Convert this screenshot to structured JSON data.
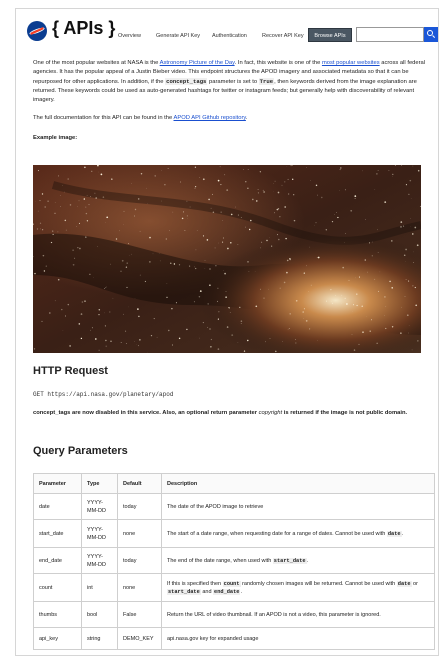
{
  "header": {
    "brand": "{ APIs }",
    "nav": [
      "Overview",
      "Generate API Key",
      "Authentication",
      "Recover API Key"
    ],
    "nav_active": "Browse APIs",
    "search_placeholder": ""
  },
  "intro": {
    "p1_a": "One of the most popular websites at NASA is the ",
    "p1_link1": "Astronomy Picture of the Day",
    "p1_b": ". In fact, this website is one of the ",
    "p1_link2": "most popular websites",
    "p1_c": " across all federal agencies. It has the popular appeal of a Justin Bieber video. This endpoint structures the APOD imagery and associated metadata so that it can be repurposed for other applications. In addition, if the ",
    "p1_code1": "concept_tags",
    "p1_d": " parameter is set to ",
    "p1_code2": "True",
    "p1_e": ", then keywords derived from the image explanation are returned. These keywords could be used as auto-generated hashtags for twitter or instagram feeds; but generally help with discoverability of relevant imagery.",
    "p2_a": "The full documentation for this API can be found in the ",
    "p2_link": "APOD API Github repository",
    "p2_b": ".",
    "example_label": "Example image:"
  },
  "http_request": {
    "heading": "HTTP Request",
    "url": "GET https://api.nasa.gov/planetary/apod",
    "note_a": "concept_tags are now disabled in this service. Also, an optional return parameter ",
    "note_em": "copyright",
    "note_b": " is returned if the image is not public domain."
  },
  "query": {
    "heading": "Query Parameters",
    "columns": [
      "Parameter",
      "Type",
      "Default",
      "Description"
    ],
    "rows": [
      {
        "param": "date",
        "type": "YYYY-MM-DD",
        "default": "today",
        "desc_a": "The date of the APOD image to retrieve",
        "code1": "",
        "desc_b": "",
        "code2": "",
        "desc_c": "",
        "code3": "",
        "desc_d": ""
      },
      {
        "param": "start_date",
        "type": "YYYY-MM-DD",
        "default": "none",
        "desc_a": "The start of a date range, when requesting date for a range of dates. Cannot be used with ",
        "code1": "date",
        "desc_b": ".",
        "code2": "",
        "desc_c": "",
        "code3": "",
        "desc_d": ""
      },
      {
        "param": "end_date",
        "type": "YYYY-MM-DD",
        "default": "today",
        "desc_a": "The end of the date range, when used with ",
        "code1": "start_date",
        "desc_b": ".",
        "code2": "",
        "desc_c": "",
        "code3": "",
        "desc_d": ""
      },
      {
        "param": "count",
        "type": "int",
        "default": "none",
        "desc_a": "If this is specified then ",
        "code1": "count",
        "desc_b": " randomly chosen images will be returned. Cannot be used with ",
        "code2": "date",
        "desc_c": " or ",
        "code3": "start_date",
        "desc_d": " and "
      },
      {
        "param": "thumbs",
        "type": "bool",
        "default": "False",
        "desc_a": "Return the URL of video thumbnail. If an APOD is not a video, this parameter is ignored.",
        "code1": "",
        "desc_b": "",
        "code2": "",
        "desc_c": "",
        "code3": "",
        "desc_d": ""
      },
      {
        "param": "api_key",
        "type": "string",
        "default": "DEMO_KEY",
        "desc_a": "api.nasa.gov key for expanded usage",
        "code1": "",
        "desc_b": "",
        "code2": "",
        "desc_c": "",
        "code3": "",
        "desc_d": ""
      }
    ],
    "count_row_code4": "end_date",
    "count_row_end": "."
  },
  "colors": {
    "nav_active_bg": "#4a5763",
    "search_button": "#1a57d8",
    "link": "#1a4fcf"
  }
}
